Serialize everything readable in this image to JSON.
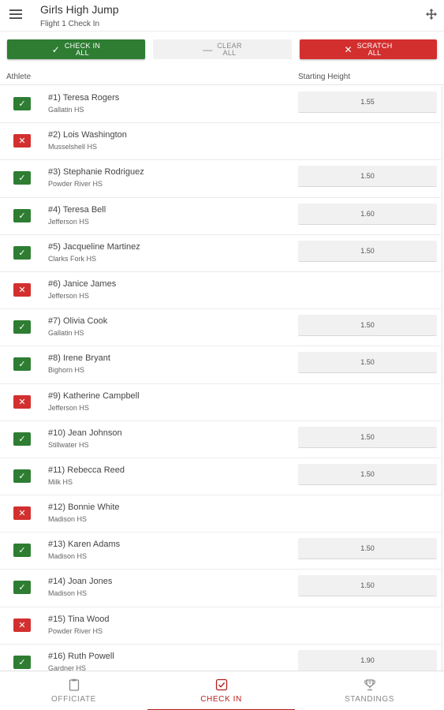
{
  "header": {
    "title": "Girls High Jump",
    "subtitle": "Flight 1 Check In"
  },
  "actions": {
    "check_in_all": "CHECK IN\nALL",
    "clear_all": "CLEAR\nALL",
    "scratch_all": "SCRATCH\nALL"
  },
  "columns": {
    "athlete": "Athlete",
    "starting_height": "Starting Height"
  },
  "athletes": [
    {
      "name": "#1) Teresa Rogers",
      "school": "Gallatin HS",
      "status": "in",
      "height": "1.55"
    },
    {
      "name": "#2) Lois Washington",
      "school": "Musselshell HS",
      "status": "out",
      "height": ""
    },
    {
      "name": "#3) Stephanie Rodriguez",
      "school": "Powder River HS",
      "status": "in",
      "height": "1.50"
    },
    {
      "name": "#4) Teresa Bell",
      "school": "Jefferson HS",
      "status": "in",
      "height": "1.60"
    },
    {
      "name": "#5) Jacqueline Martinez",
      "school": "Clarks Fork HS",
      "status": "in",
      "height": "1.50"
    },
    {
      "name": "#6) Janice James",
      "school": "Jefferson HS",
      "status": "out",
      "height": ""
    },
    {
      "name": "#7) Olivia Cook",
      "school": "Gallatin HS",
      "status": "in",
      "height": "1.50"
    },
    {
      "name": "#8) Irene Bryant",
      "school": "Bighorn HS",
      "status": "in",
      "height": "1.50"
    },
    {
      "name": "#9) Katherine Campbell",
      "school": "Jefferson HS",
      "status": "out",
      "height": ""
    },
    {
      "name": "#10) Jean Johnson",
      "school": "Stillwater HS",
      "status": "in",
      "height": "1.50"
    },
    {
      "name": "#11) Rebecca Reed",
      "school": "Milk HS",
      "status": "in",
      "height": "1.50"
    },
    {
      "name": "#12) Bonnie White",
      "school": "Madison HS",
      "status": "out",
      "height": ""
    },
    {
      "name": "#13) Karen Adams",
      "school": "Madison HS",
      "status": "in",
      "height": "1.50"
    },
    {
      "name": "#14) Joan Jones",
      "school": "Madison HS",
      "status": "in",
      "height": "1.50"
    },
    {
      "name": "#15) Tina Wood",
      "school": "Powder River HS",
      "status": "out",
      "height": ""
    },
    {
      "name": "#16) Ruth Powell",
      "school": "Gardner HS",
      "status": "in",
      "height": "1.90"
    }
  ],
  "status_glyphs": {
    "in": "✓",
    "out": "✕"
  },
  "nav": {
    "officiate": "OFFICIATE",
    "check_in": "CHECK IN",
    "standings": "STANDINGS",
    "active": "check_in"
  },
  "colors": {
    "check_in_green": "#2e7d32",
    "scratch_red": "#d32f2f",
    "accent": "#b71c1c"
  },
  "icons": {
    "menu": "menu-icon",
    "move": "move-icon",
    "officiate": "clipboard-icon",
    "check_in": "checkbox-icon",
    "standings": "trophy-icon"
  }
}
